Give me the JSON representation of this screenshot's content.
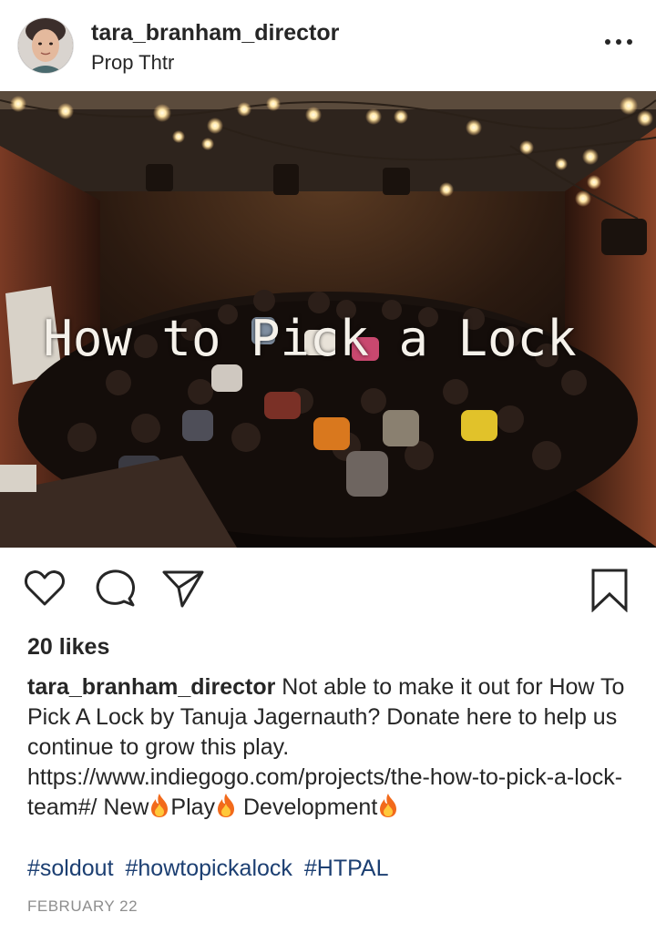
{
  "post": {
    "username": "tara_branham_director",
    "location": "Prop Thtr",
    "photo_title": "How to Pick a Lock",
    "likes": "20 likes",
    "caption": {
      "username": "tara_branham_director",
      "text_1": " Not able to make it out for How To Pick A Lock by Tanuja Jagernauth? Donate here to help us continue to grow this play. https://www.indiegogo.com/projects/the-how-to-pick-a-lock-team#/ New",
      "text_2": "Play",
      "text_3": "Development"
    },
    "hashtags": [
      "#soldout",
      "#howtopickalock",
      "#HTPAL"
    ],
    "date": "FEBRUARY 22"
  },
  "icons": {
    "more": "more-options-icon",
    "like": "heart-icon",
    "comment": "comment-icon",
    "share": "paper-plane-icon",
    "save": "bookmark-icon",
    "emoji": "fire-emoji-icon"
  },
  "colors": {
    "text": "#262626",
    "hashtag": "#1c3f72",
    "muted": "#8e8e8e"
  }
}
